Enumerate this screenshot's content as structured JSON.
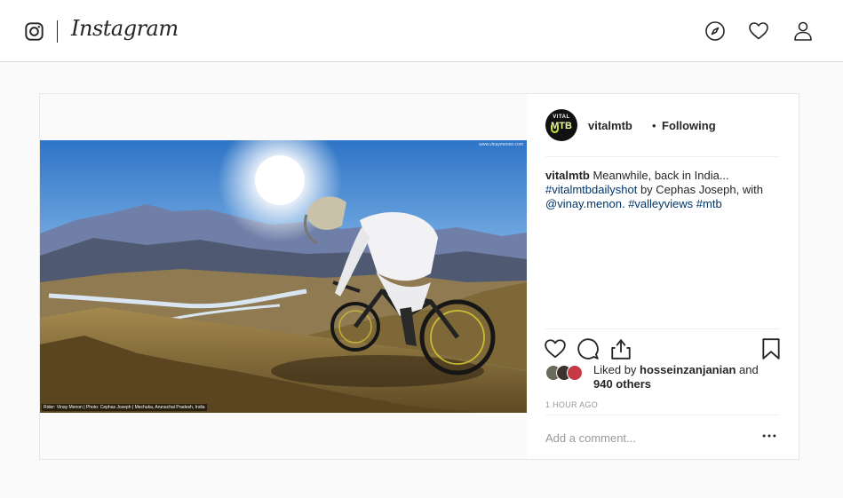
{
  "topbar": {
    "brand": "Instagram",
    "icons": {
      "logo": "instagram-camera-icon",
      "explore": "compass-icon",
      "activity": "heart-icon",
      "profile": "person-icon"
    }
  },
  "post": {
    "photo": {
      "credit_text": "Rider: Vinay Menon | Photo: Cephas Joseph | Mechuka, Arunachal Pradesh, India",
      "watermark": "www.vinaymenon.com"
    },
    "author": {
      "username": "vitalmtb",
      "separator": "•",
      "follow_status": "Following",
      "avatar_text_top": "VITAL",
      "avatar_text_main": "MTB"
    },
    "caption": {
      "username": "vitalmtb",
      "text_1": " Meanwhile, back in India...",
      "hashtag_1": "#vitalmtbdailyshot",
      "text_2": " by Cephas Joseph, with ",
      "mention": "@vinay.menon",
      "text_3": ". ",
      "hashtag_2": "#valleyviews",
      "text_4": " ",
      "hashtag_3": "#mtb"
    },
    "likes": {
      "prefix": "Liked by ",
      "liker": "hosseinzanjanian",
      "middle": " and",
      "others": "940 others"
    },
    "timestamp": "1 HOUR AGO",
    "comment_placeholder": "Add a comment...",
    "action_icons": [
      "heart-icon",
      "comment-bubble-icon",
      "share-icon",
      "bookmark-icon"
    ],
    "more_icon": "more-options-icon"
  },
  "colors": {
    "link": "#003569",
    "border": "#dbdbdb",
    "muted": "#999999",
    "background": "#fafafa"
  }
}
